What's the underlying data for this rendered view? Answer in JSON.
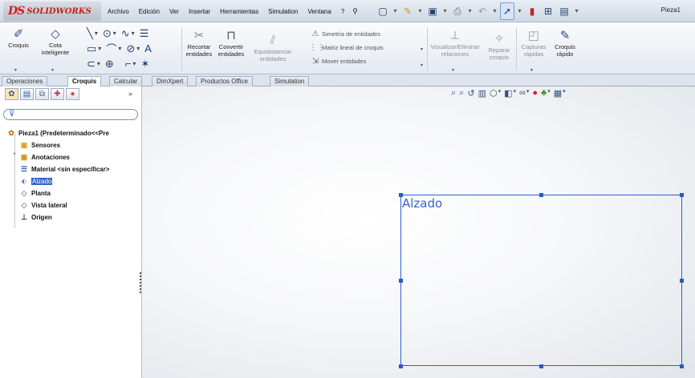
{
  "app": {
    "logo_mark": "DS",
    "logo_text": "SOLIDWORKS",
    "document_name": "Pieza1"
  },
  "menu": {
    "items": [
      "Archivo",
      "Edición",
      "Ver",
      "Insertar",
      "Herramientas",
      "Simulation",
      "Ventana",
      "?"
    ],
    "pin_icon": "pin-icon"
  },
  "ribbon": {
    "croquis": "Croquis",
    "cota_line1": "Cota",
    "cota_line2": "inteligente",
    "recortar_line1": "Recortar",
    "recortar_line2": "entidades",
    "convertir_line1": "Convertir",
    "convertir_line2": "entidades",
    "equidistanciar_line1": "Equidistanciar",
    "equidistanciar_line2": "entidades",
    "simetria": "Simetría de entidades",
    "matriz": "Matriz lineal de croquis",
    "mover": "Mover entidades",
    "visualizar_line1": "Visualizar/Eliminar",
    "visualizar_line2": "relaciones",
    "reparar_line1": "Reparar",
    "reparar_line2": "croquis",
    "capturas_line1": "Capturas",
    "capturas_line2": "rápidas",
    "croquis_rapido_line1": "Croquis",
    "croquis_rapido_line2": "rápido"
  },
  "tabs": [
    "Operaciones",
    "Croquis",
    "Calcular",
    "DimXpert",
    "Productos Office",
    "Simulation"
  ],
  "active_tab": "Croquis",
  "tree": {
    "root": "Pieza1  (Predeterminado<<Pre",
    "items": [
      {
        "label": "Sensores",
        "icon": "sensor-folder-icon"
      },
      {
        "label": "Anotaciones",
        "icon": "annotations-icon"
      },
      {
        "label": "Material <sin especificar>",
        "icon": "material-icon"
      },
      {
        "label": "Alzado",
        "icon": "plane-icon",
        "selected": true
      },
      {
        "label": "Planta",
        "icon": "plane-icon"
      },
      {
        "label": "Vista lateral",
        "icon": "plane-icon"
      },
      {
        "label": "Origen",
        "icon": "origin-icon"
      }
    ]
  },
  "viewport": {
    "plane_label": "Alzado",
    "plane_color": "#2f5fd1"
  }
}
